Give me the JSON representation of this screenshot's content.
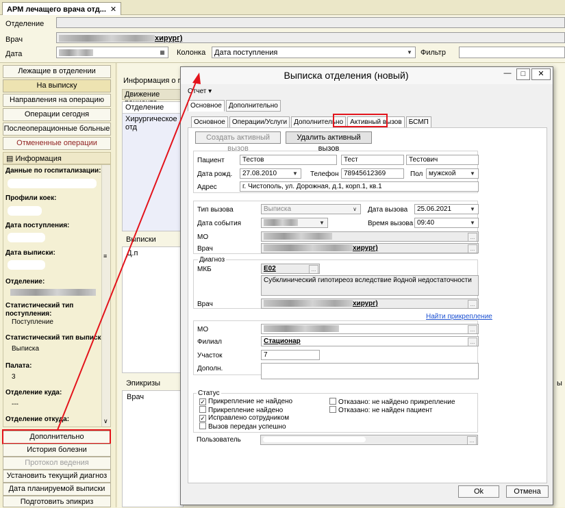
{
  "doc_tab": {
    "label": "АРМ лечащего врача отд...",
    "close": "✕"
  },
  "header": {
    "department_label": "Отделение",
    "doctor_label": "Врач",
    "doctor_suffix": "хирург)",
    "date_label": "Дата",
    "column_label": "Колонка",
    "column_value": "Дата поступления",
    "filter_label": "Фильтр"
  },
  "nav": {
    "items": [
      {
        "label": "Лежащие в отделении"
      },
      {
        "label": "На выписку"
      },
      {
        "label": "Направления на операцию"
      },
      {
        "label": "Операции сегодня"
      },
      {
        "label": "Послеоперационные больные"
      },
      {
        "label": "Отмененные операции"
      }
    ],
    "info_header": "Информация",
    "bottom": [
      {
        "label": "Дополнительно"
      },
      {
        "label": "История болезни"
      },
      {
        "label": "Протокол ведения"
      },
      {
        "label": "Установить текущий диагноз"
      },
      {
        "label": "Дата планируемой выписки"
      },
      {
        "label": "Подготовить эпикриз"
      }
    ]
  },
  "info_panel": {
    "hosp_data": "Данные по госпитализации:",
    "bed_profiles": "Профили коек:",
    "admission_date": "Дата поступления:",
    "discharge_date": "Дата выписки:",
    "department": "Отделение:",
    "stat_admission": "Статистический тип поступления:",
    "stat_admission_value": "Поступление",
    "stat_discharge": "Статистический тип выписки:",
    "stat_discharge_value": "Выписка",
    "ward": "Палата:",
    "ward_value": "3",
    "dept_to": "Отделение куда:",
    "dept_to_value": "---",
    "dept_from": "Отделение откуда:"
  },
  "main_panel": {
    "info_about": "Информация о посту",
    "movement": "Движение пациента",
    "col_department": "Отделение",
    "row_department": "Хирургическое отд",
    "discharges": "Выписки",
    "d_col": "Д.п",
    "epicrises": "Эпикризы",
    "epi_doctor_col": "Врач",
    "right_cut": "ы"
  },
  "dialog": {
    "title": "Выписка отделения (новый)",
    "btn_min": "—",
    "btn_max": "□",
    "btn_close": "✕",
    "menu_report": "Отчет ▾",
    "top_tabs": [
      "Основное",
      "Дополнительно"
    ],
    "sub_tabs": [
      "Основное",
      "Операции/Услуги",
      "Дополнительно",
      "Активный вызов",
      "БСМП"
    ],
    "create_btn": "Создать активный вызов",
    "delete_btn": "Удалить активный вызов",
    "patient_label": "Пациент",
    "last_name": "Тестов",
    "first_name": "Тест",
    "middle_name": "Тестович",
    "birth_label": "Дата рожд.",
    "birth_value": "27.08.2010",
    "phone_label": "Телефон",
    "phone_value": "78945612369",
    "sex_label": "Пол",
    "sex_value": "мужской",
    "address_label": "Адрес",
    "address_value": "г. Чистополь, ул. Дорожная, д.1, корп.1, кв.1",
    "call_type_label": "Тип вызова",
    "call_type_value": "Выписка",
    "call_date_label": "Дата вызова",
    "call_date_value": "25.06.2021",
    "event_date_label": "Дата события",
    "call_time_label": "Время вызова",
    "call_time_value": "09:40",
    "mo_label": "МО",
    "doctor_label": "Врач",
    "doctor_suffix": "хирург)",
    "diagnosis_legend": "Диагноз",
    "mkb_label": "МКБ",
    "mkb_code": "E02",
    "mkb_text": "Субклинический гипотиреоз вследствие йодной недостаточности",
    "doctor2_label": "Врач",
    "find_link": "Найти прикрепление",
    "mo2_label": "МО",
    "branch_label": "Филиал",
    "branch_value": "Стационар",
    "plot_label": "Участок",
    "plot_value": "7",
    "extra_label": "Дополн.",
    "status_legend": "Статус",
    "status_items": [
      {
        "label": "Прикрепление не найдено",
        "checked": true
      },
      {
        "label": "Прикрепление найдено",
        "checked": false
      },
      {
        "label": "Исправлено сотрудником",
        "checked": true
      },
      {
        "label": "Вызов передан успешно",
        "checked": false
      }
    ],
    "status_items_right": [
      {
        "label": "Отказано: не найдено прикрепление",
        "checked": false
      },
      {
        "label": "Отказано: не найден пациент",
        "checked": false
      }
    ],
    "user_label": "Пользователь",
    "ok": "Ok",
    "cancel": "Отмена",
    "ellipsis": "..."
  }
}
